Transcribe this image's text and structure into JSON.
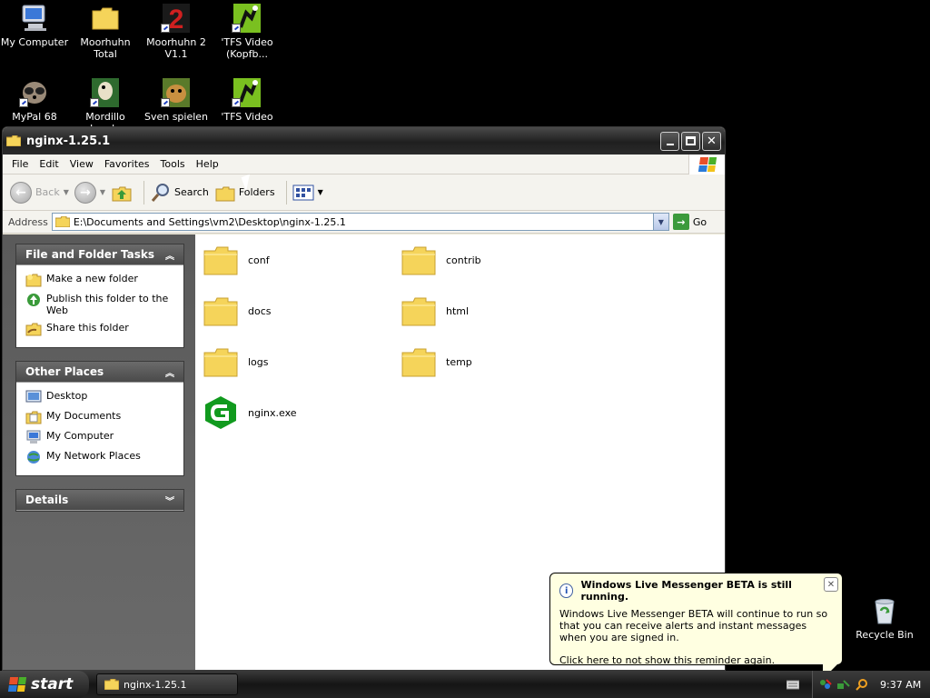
{
  "desktop": {
    "icons": [
      {
        "label": "My Computer"
      },
      {
        "label": "Moorhuhn Total"
      },
      {
        "label": "Moorhuhn 2 V1.1"
      },
      {
        "label": "'TFS Video (Kopfb..."
      },
      {
        "label": "MyPal 68"
      },
      {
        "label": "Mordillo Jungle"
      },
      {
        "label": "Sven spielen"
      },
      {
        "label": "'TFS Video"
      }
    ],
    "recycle_bin": "Recycle Bin"
  },
  "window": {
    "title": "nginx-1.25.1",
    "menu": [
      "File",
      "Edit",
      "View",
      "Favorites",
      "Tools",
      "Help"
    ],
    "toolbar": {
      "back": "Back",
      "search": "Search",
      "folders": "Folders"
    },
    "address": {
      "label": "Address",
      "value": "E:\\Documents and Settings\\vm2\\Desktop\\nginx-1.25.1",
      "go": "Go"
    },
    "left_pane": {
      "file_tasks": {
        "title": "File and Folder Tasks",
        "items": [
          "Make a new folder",
          "Publish this folder to the Web",
          "Share this folder"
        ]
      },
      "other_places": {
        "title": "Other Places",
        "items": [
          "Desktop",
          "My Documents",
          "My Computer",
          "My Network Places"
        ]
      },
      "details": {
        "title": "Details"
      }
    },
    "items": [
      {
        "name": "conf",
        "type": "folder"
      },
      {
        "name": "contrib",
        "type": "folder"
      },
      {
        "name": "docs",
        "type": "folder"
      },
      {
        "name": "html",
        "type": "folder"
      },
      {
        "name": "logs",
        "type": "folder"
      },
      {
        "name": "temp",
        "type": "folder"
      },
      {
        "name": "nginx.exe",
        "type": "exe"
      }
    ]
  },
  "balloon": {
    "title": "Windows Live Messenger BETA is still running.",
    "body": "Windows Live Messenger BETA will continue to run so that you can receive alerts and instant messages when you are signed in.",
    "link": "Click here to not show this reminder again."
  },
  "taskbar": {
    "start": "start",
    "task": "nginx-1.25.1",
    "clock": "9:37 AM"
  },
  "colors": {
    "folder": "#f5d45a",
    "nginx_green": "#119a1e",
    "balloon_bg": "#ffffe1"
  }
}
